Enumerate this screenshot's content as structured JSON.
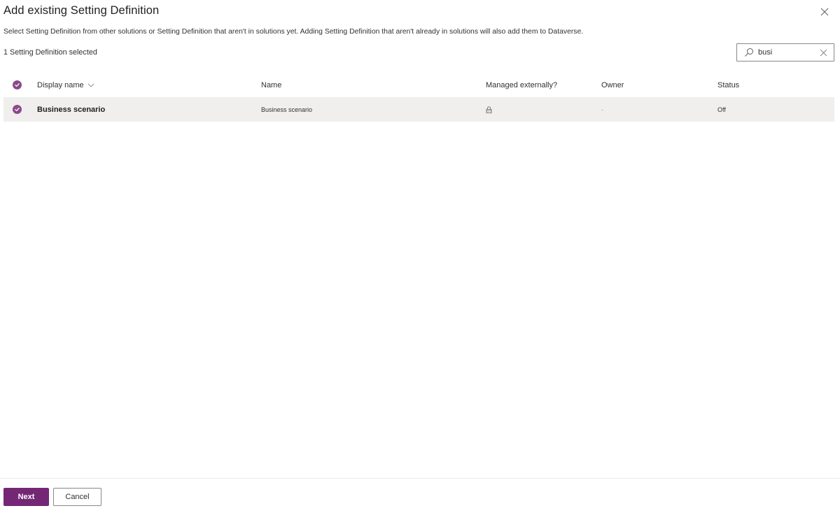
{
  "dialog": {
    "title": "Add existing Setting Definition",
    "description": "Select Setting Definition from other solutions or Setting Definition that aren't in solutions yet. Adding Setting Definition that aren't already in solutions will also add them to Dataverse.",
    "selection_count": "1 Setting Definition selected",
    "close_icon": "close-icon"
  },
  "search": {
    "value": "busi",
    "placeholder": "Search",
    "icon": "search-icon",
    "clear_icon": "clear-icon"
  },
  "grid": {
    "columns": [
      {
        "label": "Display name",
        "sortable": true,
        "sort_icon": "chevron-down-icon"
      },
      {
        "label": "Name"
      },
      {
        "label": "Managed externally?"
      },
      {
        "label": "Owner"
      },
      {
        "label": "Status"
      }
    ],
    "select_all_checked": true,
    "rows": [
      {
        "selected": true,
        "display_name": "Business scenario",
        "name": "Business scenario",
        "managed_externally_icon": "lock-icon",
        "owner": "-",
        "status": "Off"
      }
    ]
  },
  "footer": {
    "next_label": "Next",
    "cancel_label": "Cancel"
  },
  "colors": {
    "accent": "#742774",
    "selected_row_bg": "#f0efee",
    "text": "#323130",
    "border": "#8a8886"
  }
}
